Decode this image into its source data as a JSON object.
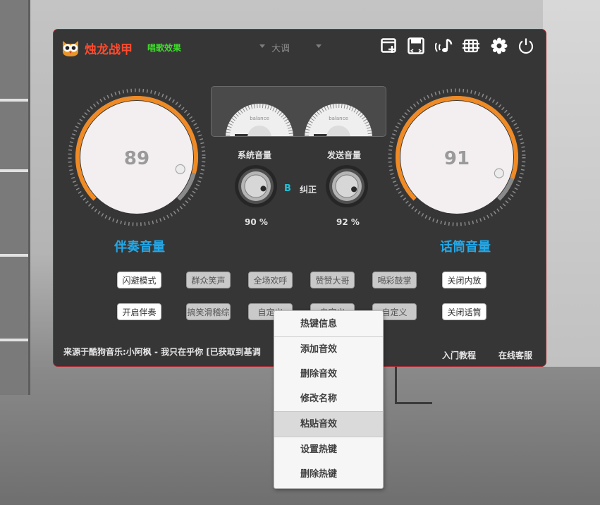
{
  "app": {
    "title": "烛龙战甲",
    "mode_label": "唱歌效果",
    "key": {
      "value": "大调"
    }
  },
  "toolbar": {
    "icons": [
      "add-window-icon",
      "save-preset-icon",
      "music-note-icon",
      "eq-settings-icon",
      "settings-icon",
      "power-icon"
    ]
  },
  "left_dial": {
    "value": "89",
    "label": "伴奏音量"
  },
  "right_dial": {
    "value": "91",
    "label": "话筒音量"
  },
  "meters": {
    "left_caption": "balance",
    "right_caption": "balance"
  },
  "knobs": {
    "system": {
      "label": "系统音量",
      "value": "90 %",
      "percent": 90
    },
    "send": {
      "label": "发送音量",
      "value": "92 %",
      "percent": 92
    }
  },
  "correction": {
    "badge": "B",
    "label": "纠正"
  },
  "effects": {
    "row1": [
      "闪避模式",
      "群众笑声",
      "全场欢呼",
      "赞赞大哥",
      "喝彩鼓掌",
      "关闭内放"
    ],
    "row2": [
      "开启伴奏",
      "搞笑滑稽综",
      "自定义",
      "自定义",
      "自定义",
      "关闭话筒"
    ]
  },
  "footer": {
    "now_playing": "来源于酷狗音乐:小阿枫 - 我只在乎你 [已获取到基调",
    "links": [
      "入门教程",
      "在线客服"
    ]
  },
  "context_menu": {
    "items": [
      "热键信息",
      "添加音效",
      "删除音效",
      "修改名称",
      "粘贴音效",
      "设置热键",
      "删除热键"
    ],
    "highlighted": "粘贴音效"
  },
  "colors": {
    "panel_bg": "#363636",
    "panel_border": "#a0272f",
    "title_red": "#ff4b2f",
    "mode_green": "#3ddc29",
    "dial_accent": "#f08a24",
    "dial_label_blue": "#23a8e8",
    "toggle_cyan": "#1fc2d8"
  }
}
